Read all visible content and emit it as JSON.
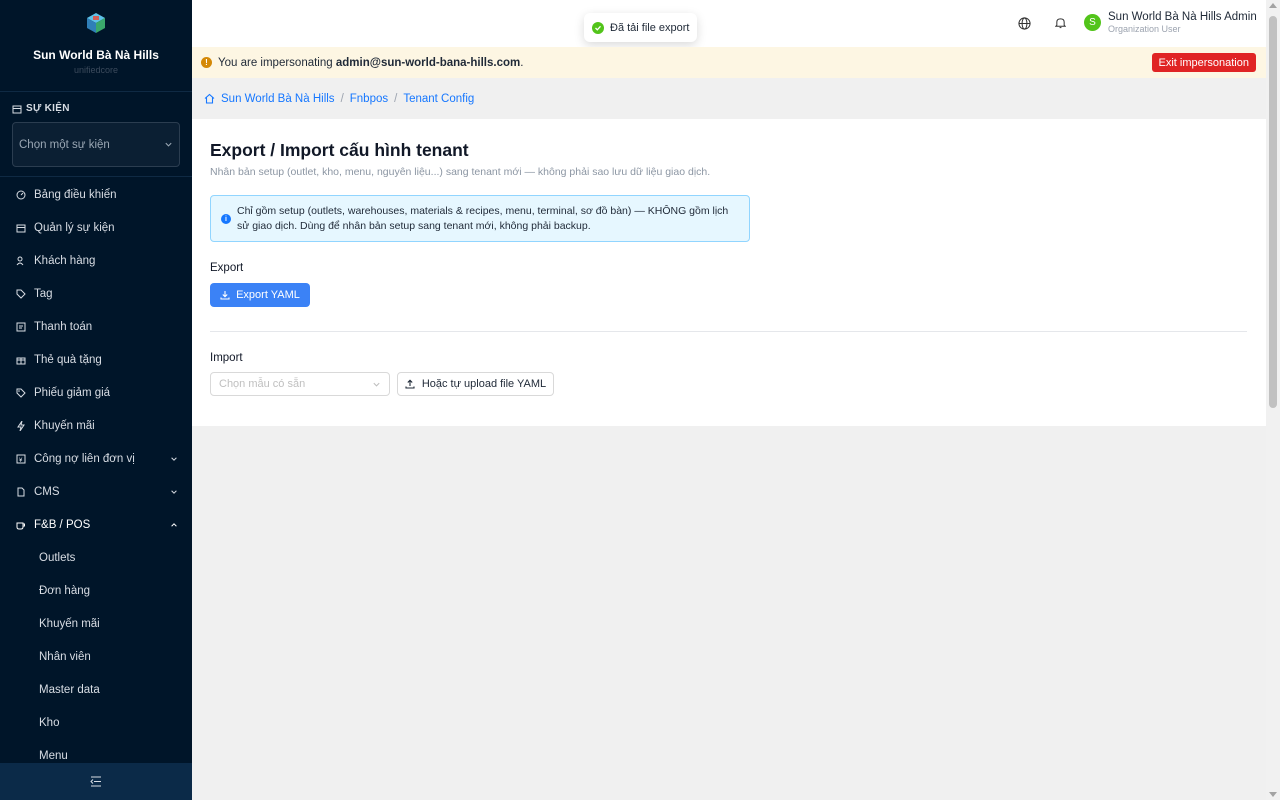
{
  "sidebar": {
    "org_name": "Sun World Bà Nà Hills",
    "org_sub": "unifiedcore",
    "event_section_label": "SỰ KIỆN",
    "event_select_placeholder": "Chọn một sự kiện",
    "menu": [
      {
        "label": "Bảng điều khiển",
        "icon": "dashboard-icon"
      },
      {
        "label": "Quản lý sự kiện",
        "icon": "calendar-icon"
      },
      {
        "label": "Khách hàng",
        "icon": "users-icon"
      },
      {
        "label": "Tag",
        "icon": "tag-icon"
      },
      {
        "label": "Thanh toán",
        "icon": "payment-icon"
      },
      {
        "label": "Thẻ quà tặng",
        "icon": "gift-icon"
      },
      {
        "label": "Phiếu giảm giá",
        "icon": "coupon-icon"
      },
      {
        "label": "Khuyến mãi",
        "icon": "lightning-icon"
      },
      {
        "label": "Công nợ liên đơn vị",
        "icon": "ledger-icon"
      },
      {
        "label": "CMS",
        "icon": "document-icon"
      },
      {
        "label": "F&B / POS",
        "icon": "coffee-icon"
      }
    ],
    "fnb_submenu": [
      "Outlets",
      "Đơn hàng",
      "Khuyến mãi",
      "Nhân viên",
      "Master data",
      "Kho",
      "Menu"
    ]
  },
  "header": {
    "toast": "Đã tải file export",
    "user_name": "Sun World Bà Nà Hills Admin",
    "user_role": "Organization User",
    "avatar_initial": "S"
  },
  "impersonation": {
    "prefix": "You are impersonating",
    "email": "admin@sun-world-bana-hills.com",
    "suffix": ".",
    "exit_label": "Exit impersonation"
  },
  "breadcrumb": {
    "home": "Sun World Bà Nà Hills",
    "level2": "Fnbpos",
    "level3": "Tenant Config"
  },
  "page": {
    "title": "Export / Import cấu hình tenant",
    "subtitle": "Nhân bản setup (outlet, kho, menu, nguyên liệu...) sang tenant mới — không phải sao lưu dữ liệu giao dịch.",
    "info_text": "Chỉ gồm setup (outlets, warehouses, materials & recipes, menu, terminal, sơ đồ bàn) — KHÔNG gồm lịch sử giao dịch. Dùng để nhân bản setup sang tenant mới, không phải backup.",
    "export_label": "Export",
    "export_button": "Export YAML",
    "import_label": "Import",
    "template_placeholder": "Chọn mẫu có sẵn",
    "upload_button": "Hoặc tự upload file YAML"
  },
  "colors": {
    "sidebar_bg": "#001529",
    "primary": "#3b82f6",
    "danger": "#e02424",
    "success": "#52c41a"
  }
}
